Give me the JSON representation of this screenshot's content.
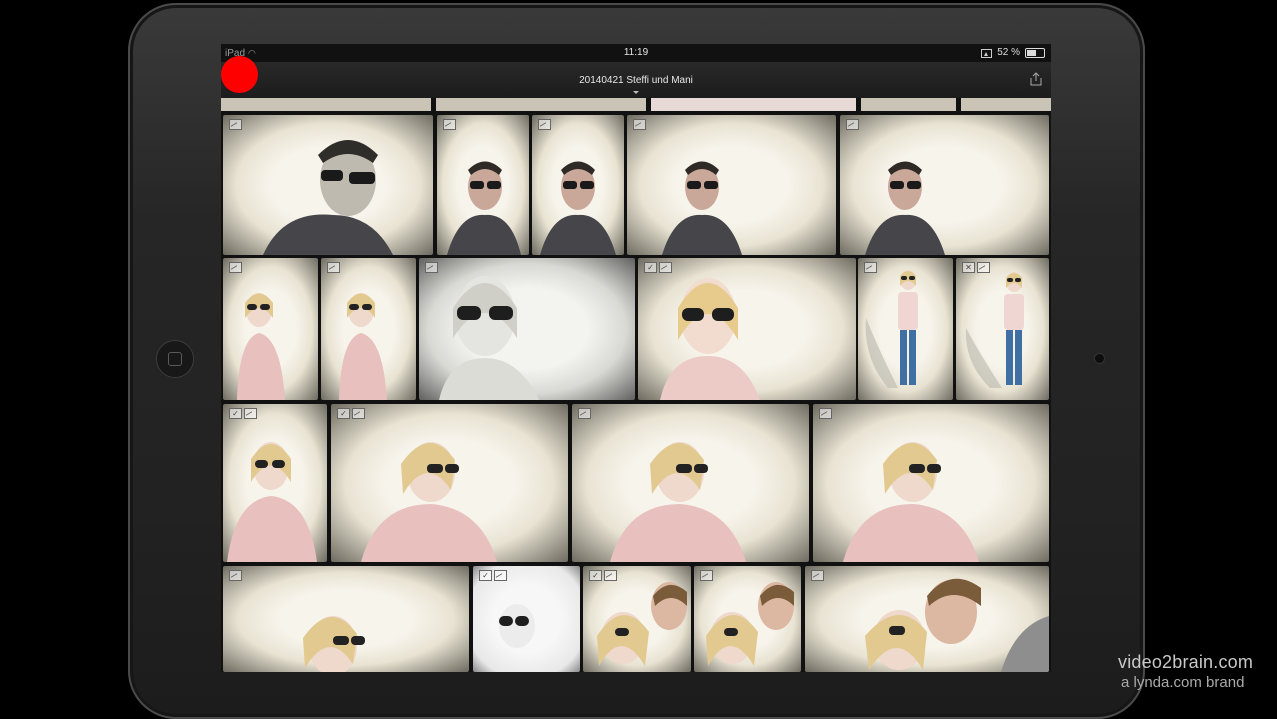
{
  "status_bar": {
    "device": "iPad",
    "time": "11:19",
    "battery": "52 %"
  },
  "navbar": {
    "title": "20140421 Steffi und Mani"
  },
  "icons": {
    "wifi": "wifi-icon",
    "airplay": "airplay-icon",
    "battery": "battery-icon",
    "share": "share-icon",
    "flag": "flag-icon",
    "check": "checkmark-icon",
    "record": "record-dot-icon"
  },
  "colors": {
    "record": "#ff0000",
    "device_body": "#262626",
    "photo_paper": "#f4f0e6"
  },
  "watermark": {
    "line1": "video2brain.com",
    "line2": "a lynda.com brand"
  }
}
